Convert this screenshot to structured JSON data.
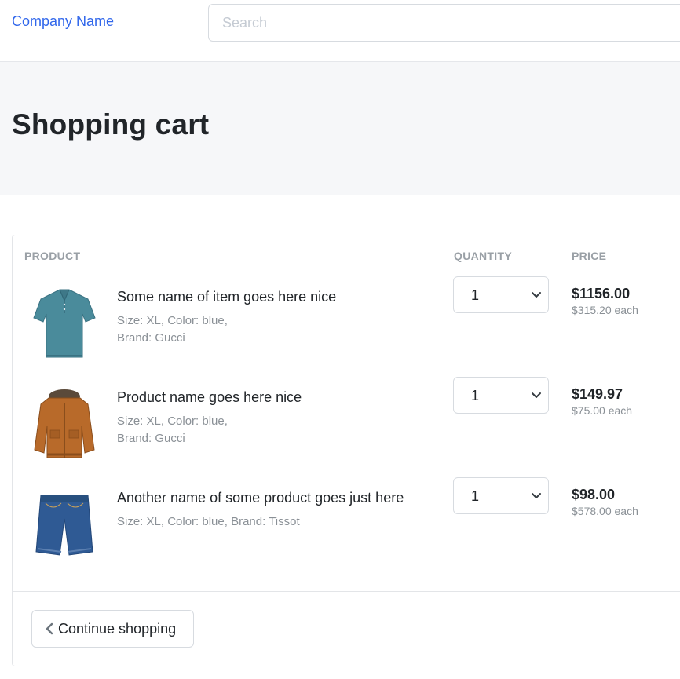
{
  "header": {
    "brand": "Company Name",
    "search_placeholder": "Search"
  },
  "page": {
    "title": "Shopping cart"
  },
  "cart": {
    "columns": {
      "product": "PRODUCT",
      "quantity": "QUANTITY",
      "price": "PRICE"
    },
    "items": [
      {
        "name": "Some name of item goes here nice",
        "meta_line1": "Size: XL, Color: blue,",
        "meta_line2": "Brand: Gucci",
        "quantity": "1",
        "price": "$1156.00",
        "each": "$315.20 each",
        "image": "polo-shirt-icon"
      },
      {
        "name": "Product name goes here nice",
        "meta_line1": "Size: XL, Color: blue,",
        "meta_line2": "Brand: Gucci",
        "quantity": "1",
        "price": "$149.97",
        "each": "$75.00 each",
        "image": "jacket-icon"
      },
      {
        "name": "Another name of some product goes just here",
        "meta_line1": "Size: XL, Color: blue, Brand: Tissot",
        "meta_line2": "",
        "quantity": "1",
        "price": "$98.00",
        "each": "$578.00 each",
        "image": "denim-shorts-icon"
      }
    ],
    "continue_label": "Continue shopping"
  },
  "colors": {
    "brand": "#3167eb",
    "hero_bg": "#f6f7f9",
    "muted_text": "#8a9096"
  }
}
